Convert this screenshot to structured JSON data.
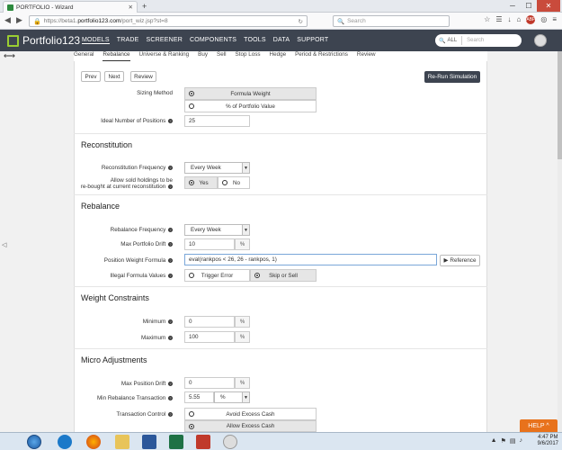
{
  "browser": {
    "tab_title": "PORTFOLIO - Wizard",
    "url_prefix": "https://beta1.",
    "url_domain": "portfolio123.com",
    "url_path": "/port_wiz.jsp?st=8",
    "search_placeholder": "Search"
  },
  "header": {
    "logo_text": "Portfolio123",
    "nav": [
      "MODELS",
      "TRADE",
      "SCREENER",
      "COMPONENTS",
      "TOOLS",
      "DATA",
      "SUPPORT"
    ],
    "search_scope": "ALL",
    "search_placeholder": "Search"
  },
  "subnav": [
    "General",
    "Rebalance",
    "Universe & Ranking",
    "Buy",
    "Sell",
    "Stop Loss",
    "Hedge",
    "Period & Restrictions",
    "Review"
  ],
  "buttons": {
    "prev": "Prev",
    "next": "Next",
    "review": "Review",
    "rerun": "Re-Run Simulation",
    "reference": "Reference"
  },
  "sizing": {
    "label": "Sizing Method",
    "options": [
      "Formula Weight",
      "% of Portfolio Value"
    ],
    "ideal_label": "Ideal Number of Positions",
    "ideal_value": "25"
  },
  "reconstitution": {
    "title": "Reconstitution",
    "freq_label": "Reconstitution Frequency",
    "freq_value": "Every Week",
    "allow_label_1": "Allow sold holdings to be",
    "allow_label_2": "re-bought at current reconstitution",
    "yes": "Yes",
    "no": "No"
  },
  "rebalance": {
    "title": "Rebalance",
    "freq_label": "Rebalance Frequency",
    "freq_value": "Every Week",
    "drift_label": "Max Portfolio Drift",
    "drift_value": "10",
    "drift_unit": "%",
    "pwf_label": "Position Weight Formula",
    "pwf_value": "eval(rankpos < 26, 26 - rankpos, 1)",
    "illegal_label": "Illegal Formula Values",
    "illegal_options": [
      "Trigger Error",
      "Skip or Sell"
    ]
  },
  "weight": {
    "title": "Weight Constraints",
    "min_label": "Minimum",
    "min_value": "0",
    "max_label": "Maximum",
    "max_value": "100",
    "unit": "%"
  },
  "micro": {
    "title": "Micro Adjustments",
    "mpd_label": "Max Position Drift",
    "mpd_value": "0",
    "mrt_label": "Min Rebalance Transaction",
    "mrt_value": "5.55",
    "mrt_unit": "%",
    "tc_label": "Transaction Control",
    "tc_options": [
      "Avoid Excess Cash",
      "Allow Excess Cash"
    ]
  },
  "help_label": "HELP ^",
  "taskbar": {
    "time": "4:47 PM",
    "date": "9/6/2017"
  }
}
